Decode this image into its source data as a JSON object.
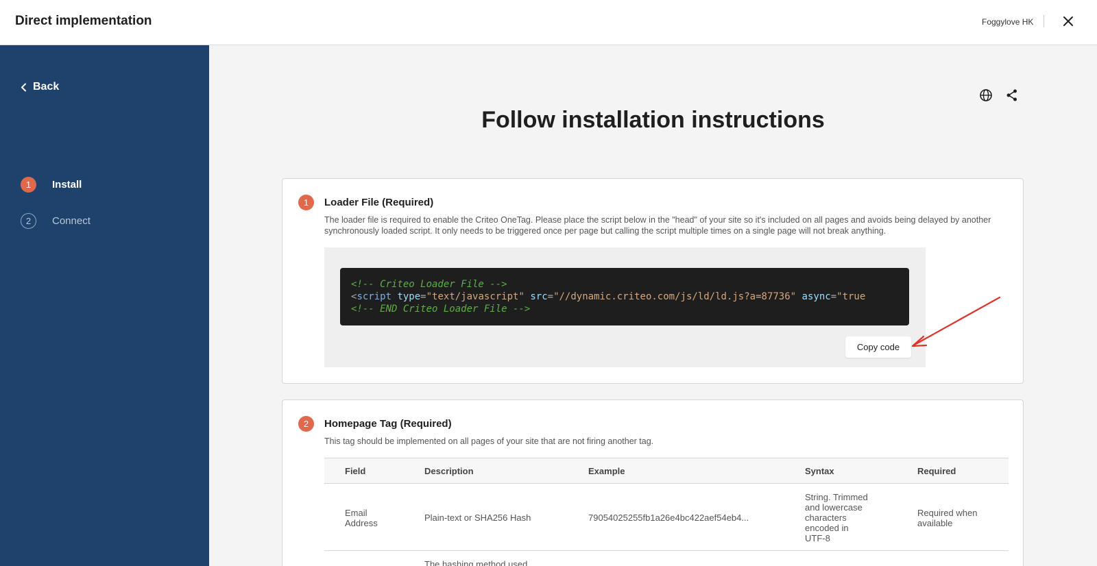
{
  "header": {
    "title": "Direct implementation",
    "account": "Foggylove HK",
    "close_icon": "close-icon"
  },
  "sidebar": {
    "back_label": "Back",
    "steps": [
      {
        "number": "1",
        "label": "Install",
        "active": true
      },
      {
        "number": "2",
        "label": "Connect",
        "active": false
      }
    ]
  },
  "main": {
    "heading": "Follow installation instructions",
    "toolbar_icons": [
      "globe-icon",
      "share-icon"
    ],
    "loader": {
      "number": "1",
      "title": "Loader File (Required)",
      "description": "The loader file is required to enable the Criteo OneTag. Please place the script below in the \"head\" of your site so it's included on all pages and avoids being delayed by another synchronously loaded script. It only needs to be triggered once per page but calling the script multiple times on a single page will not break anything.",
      "code": {
        "line1": "<!-- Criteo Loader File -->",
        "line2_open": "<",
        "line2_tag": "script",
        "line2_attr1": "type",
        "line2_eq": "=",
        "line2_val1": "\"text/javascript\"",
        "line2_attr2": "src",
        "line2_val2": "\"//dynamic.criteo.com/js/ld/ld.js?a=87736\"",
        "line2_attr3": "async",
        "line2_val3": "\"true",
        "line3": "<!-- END Criteo Loader File -->"
      },
      "copy_label": "Copy code"
    },
    "homepage": {
      "number": "2",
      "title": "Homepage Tag (Required)",
      "description": "This tag should be implemented on all pages of your site that are not firing another tag.",
      "columns": [
        "Field",
        "Description",
        "Example",
        "Syntax",
        "Required"
      ],
      "rows": [
        {
          "field": "Email Address",
          "description": "Plain-text or SHA256 Hash",
          "example": "79054025255fb1a26e4bc422aef54eb4...",
          "syntax": "String. Trimmed and lowercase characters encoded in UTF-8",
          "required": "Required when available"
        },
        {
          "field": "",
          "description": "The hashing method used for the email. Please set",
          "example": "",
          "syntax": "",
          "required": ""
        }
      ]
    }
  },
  "colors": {
    "sidebar": "#1e426b",
    "accent": "#e0694d",
    "code_bg": "#1e1e1e",
    "arrow": "#d9352c"
  }
}
